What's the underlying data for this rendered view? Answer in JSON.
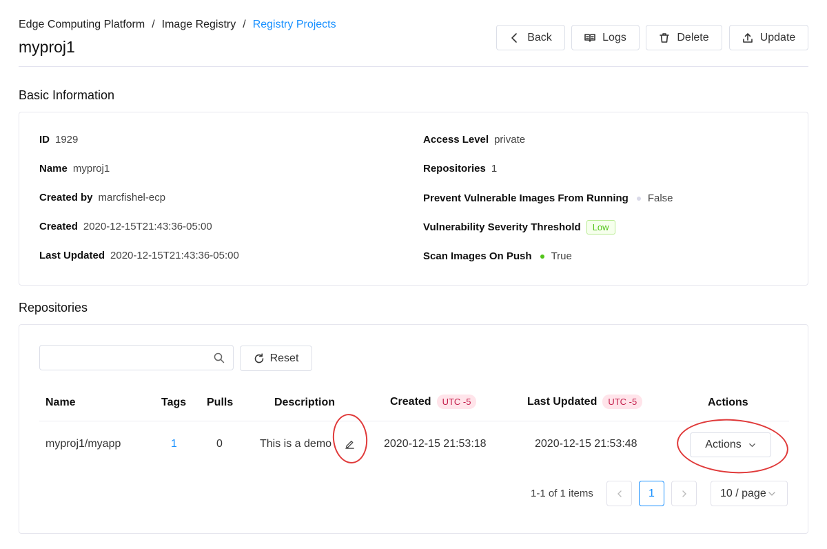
{
  "breadcrumb": {
    "items": [
      "Edge Computing Platform",
      "Image Registry"
    ],
    "separator": "/",
    "current": "Registry Projects"
  },
  "page": {
    "title": "myproj1"
  },
  "toolbar": {
    "back_label": "Back",
    "logs_label": "Logs",
    "delete_label": "Delete",
    "update_label": "Update"
  },
  "basic_info": {
    "title": "Basic Information",
    "left": [
      {
        "key": "ID",
        "value": "1929"
      },
      {
        "key": "Name",
        "value": "myproj1"
      },
      {
        "key": "Created by",
        "value": "marcfishel-ecp"
      },
      {
        "key": "Created",
        "value": "2020-12-15T21:43:36-05:00"
      },
      {
        "key": "Last Updated",
        "value": "2020-12-15T21:43:36-05:00"
      }
    ],
    "right": [
      {
        "key": "Access Level",
        "value": "private"
      },
      {
        "key": "Repositories",
        "value": "1"
      },
      {
        "key": "Prevent Vulnerable Images From Running",
        "value": "False",
        "status_color": "#d9d9e8"
      },
      {
        "key": "Vulnerability Severity Threshold",
        "value": "Low"
      },
      {
        "key": "Scan Images On Push",
        "value": "True",
        "status_color": "#52c41a"
      }
    ]
  },
  "repositories": {
    "title": "Repositories",
    "search": {
      "placeholder": "",
      "icon": "search-icon"
    },
    "reset_label": "Reset",
    "columns": {
      "name": "Name",
      "tags": "Tags",
      "pulls": "Pulls",
      "description": "Description",
      "created": "Created",
      "last_updated": "Last Updated",
      "actions": "Actions",
      "tz_badge": "UTC -5"
    },
    "rows": [
      {
        "name": "myproj1/myapp",
        "tags": "1",
        "pulls": "0",
        "description": "This is a demo",
        "created": "2020-12-15 21:53:18",
        "last_updated": "2020-12-15 21:53:48",
        "actions_label": "Actions"
      }
    ],
    "pagination": {
      "summary": "1-1 of 1 items",
      "current_page": "1",
      "page_size": "10 / page"
    }
  },
  "colors": {
    "accent": "#1890ff",
    "annotation": "#e03a3a",
    "badge_bg": "#ffe4ea",
    "low_tag": "#52c41a"
  }
}
